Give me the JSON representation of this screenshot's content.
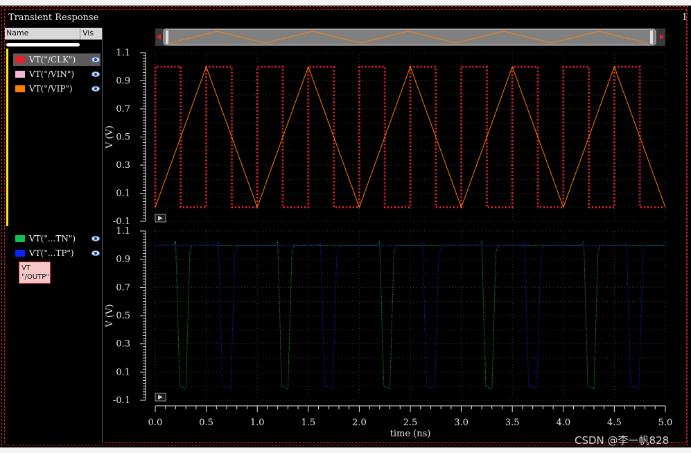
{
  "window": {
    "title": "Transient Response",
    "corner_number": "1"
  },
  "sidebar": {
    "header": {
      "name": "Name",
      "vis": "Vis"
    },
    "signals": [
      {
        "label": "VT(\"/CLK\")",
        "color": "#e8202a",
        "selected": true
      },
      {
        "label": "VT(\"/VIN\")",
        "color": "#f7b6d9",
        "selected": false
      },
      {
        "label": "VT(\"/VIP\")",
        "color": "#ff7f00",
        "selected": false
      },
      {
        "label": "VT(\"...TN\")",
        "color": "#10c050",
        "selected": false
      },
      {
        "label": "VT(\"...TP\")",
        "color": "#1020ff",
        "selected": false
      }
    ],
    "tooltip": {
      "line1": "VT",
      "line2": "\"/OUTP\""
    },
    "eye_icon": "eye-icon"
  },
  "watermark": "CSDN @李一帆828",
  "chart_data": [
    {
      "type": "line",
      "ylabel": "V (V)",
      "yticks": [
        "1.1",
        "0.9",
        "0.7",
        "0.5",
        "0.3",
        "0.1",
        "-0.1"
      ],
      "ylim": [
        -0.1,
        1.1
      ],
      "xlim": [
        0,
        5
      ],
      "grid": true,
      "series": [
        {
          "name": "VT(\"/CLK\")",
          "color": "#e8202a",
          "style": "dotted",
          "x": [
            0.0,
            0.0,
            0.25,
            0.25,
            0.5,
            0.5,
            0.75,
            0.75,
            1.0,
            1.0,
            1.25,
            1.25,
            1.5,
            1.5,
            1.75,
            1.75,
            2.0,
            2.0,
            2.25,
            2.25,
            2.5,
            2.5,
            2.75,
            2.75,
            3.0,
            3.0,
            3.25,
            3.25,
            3.5,
            3.5,
            3.75,
            3.75,
            4.0,
            4.0,
            4.25,
            4.25,
            4.5,
            4.5,
            4.75,
            4.75,
            5.0
          ],
          "y": [
            0.0,
            1.0,
            1.0,
            0.0,
            0.0,
            1.0,
            1.0,
            0.0,
            0.0,
            1.0,
            1.0,
            0.0,
            0.0,
            1.0,
            1.0,
            0.0,
            0.0,
            1.0,
            1.0,
            0.0,
            0.0,
            1.0,
            1.0,
            0.0,
            0.0,
            1.0,
            1.0,
            0.0,
            0.0,
            1.0,
            1.0,
            0.0,
            0.0,
            1.0,
            1.0,
            0.0,
            0.0,
            1.0,
            1.0,
            0.0,
            0.0
          ]
        },
        {
          "name": "VT(\"/VIP\")",
          "color": "#ff7f00",
          "style": "solid",
          "x": [
            0.0,
            0.5,
            1.0,
            1.5,
            2.0,
            2.5,
            3.0,
            3.5,
            4.0,
            4.5,
            5.0
          ],
          "y": [
            0.0,
            1.0,
            0.0,
            1.0,
            0.0,
            1.0,
            0.0,
            1.0,
            0.0,
            1.0,
            0.0
          ]
        }
      ]
    },
    {
      "type": "line",
      "xlabel": "time (ns)",
      "ylabel": "V (V)",
      "xticks": [
        "0.0",
        "0.5",
        "1.0",
        "1.5",
        "2.0",
        "2.5",
        "3.0",
        "3.5",
        "4.0",
        "4.5",
        "5.0"
      ],
      "yticks": [
        "1.1",
        "0.9",
        "0.7",
        "0.5",
        "0.3",
        "0.1",
        "-0.1"
      ],
      "ylim": [
        -0.1,
        1.1
      ],
      "xlim": [
        0,
        5
      ],
      "grid": true,
      "series": [
        {
          "name": "VT(\"...TN\")",
          "color": "#10c050",
          "style": "dotted",
          "x": [
            0.0,
            0.18,
            0.2,
            0.24,
            0.3,
            0.34,
            0.36,
            1.0,
            1.18,
            1.2,
            1.24,
            1.3,
            1.34,
            1.36,
            2.0,
            2.18,
            2.2,
            2.24,
            2.3,
            2.34,
            2.36,
            3.0,
            3.18,
            3.2,
            3.24,
            3.3,
            3.34,
            3.36,
            4.0,
            4.18,
            4.2,
            4.24,
            4.3,
            4.34,
            4.36,
            5.0
          ],
          "y": [
            1.0,
            1.0,
            1.03,
            0.0,
            -0.02,
            0.95,
            1.0,
            1.0,
            1.0,
            1.03,
            0.0,
            -0.02,
            0.95,
            1.0,
            1.0,
            1.0,
            1.03,
            0.0,
            -0.02,
            0.95,
            1.0,
            1.0,
            1.0,
            1.03,
            0.0,
            -0.02,
            0.95,
            1.0,
            1.0,
            1.0,
            1.03,
            0.0,
            -0.02,
            0.95,
            1.0,
            1.0
          ]
        },
        {
          "name": "VT(\"...TP\")",
          "color": "#1020ff",
          "style": "dotted",
          "x": [
            0.0,
            0.6,
            0.62,
            0.66,
            0.74,
            0.78,
            0.82,
            1.6,
            1.62,
            1.66,
            1.74,
            1.78,
            1.82,
            2.6,
            2.62,
            2.66,
            2.74,
            2.78,
            2.82,
            3.6,
            3.62,
            3.66,
            3.74,
            3.78,
            3.82,
            4.6,
            4.62,
            4.66,
            4.74,
            4.78,
            4.82,
            5.0
          ],
          "y": [
            1.0,
            1.0,
            1.02,
            0.0,
            -0.02,
            0.95,
            1.0,
            1.0,
            1.02,
            0.0,
            -0.02,
            0.95,
            1.0,
            1.0,
            1.02,
            0.0,
            -0.02,
            0.95,
            1.0,
            1.0,
            1.02,
            0.0,
            -0.02,
            0.95,
            1.0,
            1.0,
            1.02,
            0.0,
            -0.02,
            0.95,
            1.0,
            1.0
          ]
        }
      ]
    }
  ]
}
